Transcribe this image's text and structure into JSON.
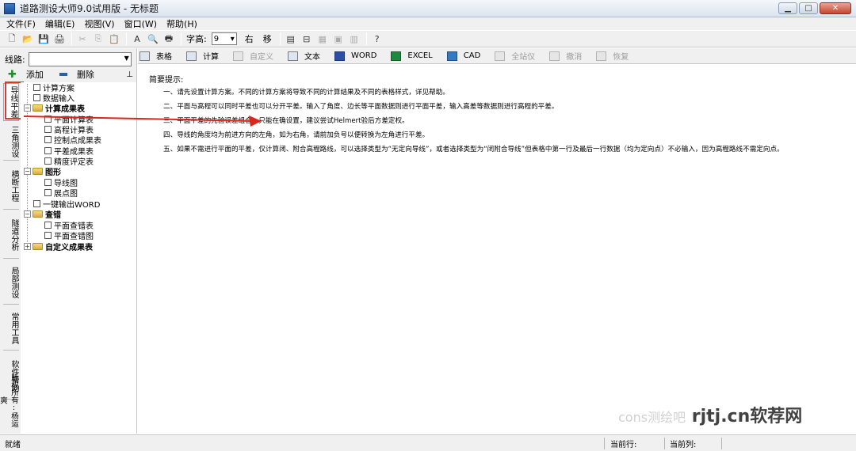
{
  "window": {
    "title": "道路测设大师9.0试用版 - 无标题",
    "buttons": [
      "▁",
      "□",
      "✕"
    ]
  },
  "menu": [
    "文件(F)",
    "编辑(E)",
    "视图(V)",
    "窗口(W)",
    "帮助(H)"
  ],
  "toolbar": {
    "font_size_label": "字高:",
    "font_size_value": "9",
    "right_label": "右",
    "move_label": "移"
  },
  "left": {
    "route_label": "线路:",
    "route_value": "",
    "add_label": "添加",
    "delete_label": "删除",
    "pin_icon": "pin-icon",
    "vertical_tabs": [
      "导线平差",
      "三角测设",
      "横断工程",
      "隧道分析",
      "局部测设",
      "常用工具",
      "软件帮助",
      "版权所有:杨运爽"
    ],
    "tree": {
      "calc_plan": "计算方案",
      "data_input": "数据输入",
      "results": "计算成果表",
      "plane_calc": "平面计算表",
      "elev_calc": "高程计算表",
      "control_pts": "控制点成果表",
      "adj_results": "平差成果表",
      "accuracy": "精度评定表",
      "graphics": "图形",
      "traverse_map": "导线图",
      "point_map": "展点图",
      "export_word": "一键输出WORD",
      "check": "查错",
      "plane_check_table": "平面查错表",
      "plane_check_map": "平面查错图",
      "custom_results": "自定义成果表"
    }
  },
  "right_toolbar": {
    "table": "表格",
    "calc": "计算",
    "custom": "自定义",
    "text": "文本",
    "word": "WORD",
    "excel": "EXCEL",
    "cad": "CAD",
    "total_station": "全站仪",
    "undo": "撤消",
    "redo": "恢复"
  },
  "content": {
    "title": "简要提示:",
    "hints": [
      "一、请先设置计算方案。不同的计算方案将导致不同的计算结果及不同的表格样式，详见帮助。",
      "二、平面与高程可以同时平差也可以分开平差。输入了角度、边长等平面数据则进行平面平差，输入高差等数据则进行高程的平差。",
      "三、平面平差的先验误差组合，只能在确设置，建议尝试Helmert验后方差定权。",
      "四、导线的角度均为前进方向的左角，如为右角，请前加负号以便转换为左角进行平差。",
      "五、如果不需进行平面的平差，仅计算闭、附合高程路线，可以选择类型为“无定向导线”，或者选择类型为“闭附合导线”但表格中第一行及最后一行数据（均为定向点）不必输入，因为高程路线不需定向点。"
    ]
  },
  "status": {
    "ready": "就绪",
    "current_row": "当前行:",
    "current_col": "当前列:"
  },
  "watermark": {
    "faint": "cons测绘吧",
    "text": "rjtj.cn软荐网"
  }
}
